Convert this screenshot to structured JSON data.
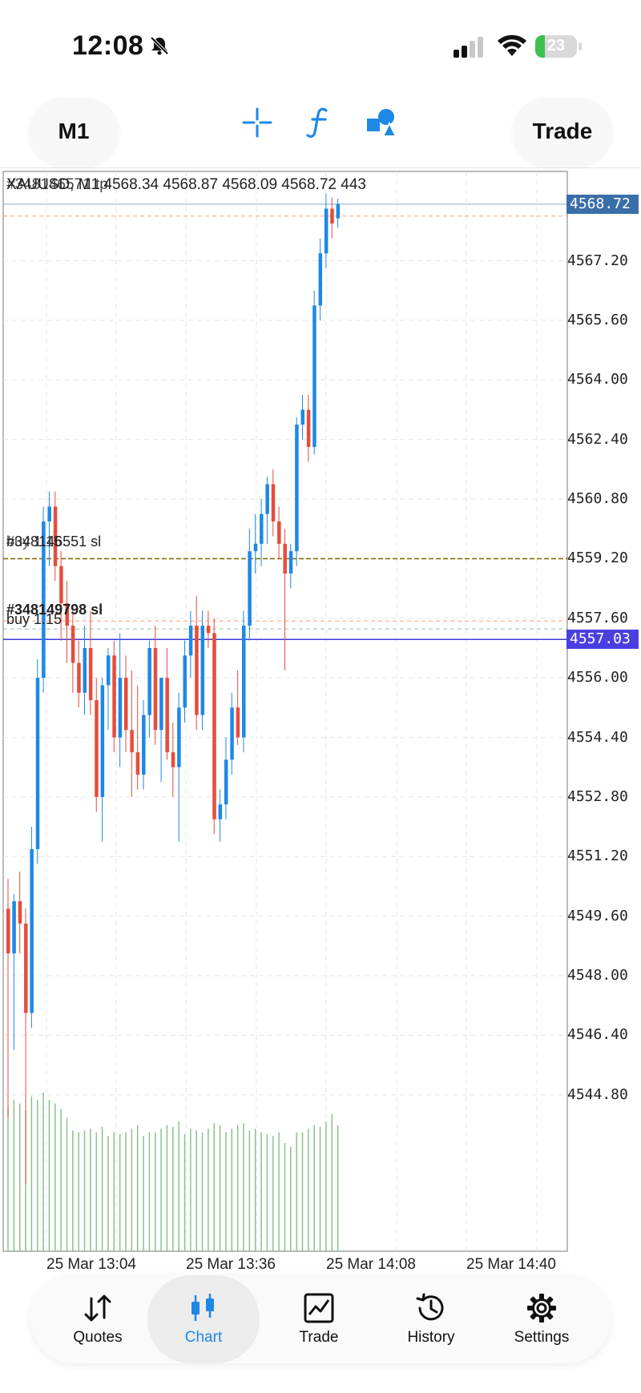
{
  "status_bar": {
    "time": "12:08",
    "battery": "23",
    "battery_level": 0.23
  },
  "toolbar": {
    "timeframe": "M1",
    "trade_label": "Trade",
    "icons": [
      "crosshair-icon",
      "function-icon",
      "objects-icon"
    ]
  },
  "chart": {
    "caption": "XAUUSD, M1 4568.34 4568.87 4568.09 4568.72 443",
    "caption_overlay": "#348146571 tp",
    "orders": [
      {
        "label": "#348146551 sl",
        "sub": "buy 1.15"
      },
      {
        "label": "#348149798 sl",
        "sub": "buy 1.15"
      }
    ],
    "current_price": "4568.72",
    "line_price": "4557.03"
  },
  "chart_data": {
    "type": "candlestick",
    "symbol": "XAUUSD",
    "timeframe": "M1",
    "ohlc_header": {
      "open": 4568.34,
      "high": 4568.87,
      "low": 4568.09,
      "close": 4568.72,
      "volume": 443
    },
    "y_ticks": [
      "4567.20",
      "4565.60",
      "4564.00",
      "4562.40",
      "4560.80",
      "4559.20",
      "4557.60",
      "4556.00",
      "4554.40",
      "4552.80",
      "4551.20",
      "4549.60",
      "4548.00",
      "4546.40",
      "4544.80"
    ],
    "x_ticks": [
      "25 Mar 13:04",
      "25 Mar 13:36",
      "25 Mar 14:08",
      "25 Mar 14:40"
    ],
    "ylim": [
      4540.6,
      4569.6
    ],
    "levels": {
      "tp": 4568.4,
      "sl_upper": 4559.2,
      "sl_lower": 4557.4,
      "blue_line": 4557.03,
      "current": 4568.72
    },
    "candles": [
      [
        4549.8,
        4550.6,
        4544.2,
        4548.6
      ],
      [
        4548.6,
        4550.2,
        4546.0,
        4550.0
      ],
      [
        4550.0,
        4550.8,
        4548.6,
        4549.4
      ],
      [
        4549.4,
        4549.8,
        4542.4,
        4547.0
      ],
      [
        4547.0,
        4552.0,
        4546.6,
        4551.4
      ],
      [
        4551.4,
        4556.5,
        4551.0,
        4556.0
      ],
      [
        4556.0,
        4560.6,
        4555.6,
        4560.2
      ],
      [
        4560.2,
        4561.0,
        4559.0,
        4560.6
      ],
      [
        4560.6,
        4561.0,
        4558.6,
        4559.0
      ],
      [
        4559.0,
        4559.4,
        4557.0,
        4558.0
      ],
      [
        4558.0,
        4558.6,
        4556.4,
        4557.4
      ],
      [
        4557.4,
        4557.8,
        4555.6,
        4556.4
      ],
      [
        4556.4,
        4557.0,
        4555.2,
        4555.6
      ],
      [
        4555.6,
        4557.4,
        4555.0,
        4556.8
      ],
      [
        4556.8,
        4557.8,
        4555.0,
        4555.4
      ],
      [
        4555.4,
        4556.0,
        4552.4,
        4552.8
      ],
      [
        4552.8,
        4556.0,
        4551.6,
        4555.8
      ],
      [
        4555.8,
        4556.8,
        4554.6,
        4556.6
      ],
      [
        4556.6,
        4557.0,
        4554.0,
        4554.4
      ],
      [
        4554.4,
        4557.2,
        4553.6,
        4556.0
      ],
      [
        4556.0,
        4556.6,
        4554.0,
        4554.6
      ],
      [
        4554.6,
        4556.2,
        4552.8,
        4554.0
      ],
      [
        4554.0,
        4555.8,
        4553.0,
        4553.4
      ],
      [
        4553.4,
        4555.4,
        4553.0,
        4555.0
      ],
      [
        4555.0,
        4557.0,
        4554.4,
        4556.8
      ],
      [
        4556.8,
        4557.4,
        4554.2,
        4554.6
      ],
      [
        4554.6,
        4556.0,
        4553.2,
        4556.0
      ],
      [
        4556.0,
        4556.8,
        4553.8,
        4554.0
      ],
      [
        4554.0,
        4554.8,
        4552.8,
        4553.6
      ],
      [
        4553.6,
        4555.6,
        4551.6,
        4555.2
      ],
      [
        4555.2,
        4557.0,
        4554.8,
        4556.6
      ],
      [
        4556.6,
        4557.8,
        4556.0,
        4557.4
      ],
      [
        4557.4,
        4558.2,
        4554.6,
        4555.0
      ],
      [
        4555.0,
        4557.8,
        4554.6,
        4557.4
      ],
      [
        4557.4,
        4557.8,
        4556.8,
        4557.2
      ],
      [
        4557.2,
        4557.6,
        4551.8,
        4552.2
      ],
      [
        4552.2,
        4553.0,
        4551.6,
        4552.6
      ],
      [
        4552.6,
        4554.4,
        4552.2,
        4553.8
      ],
      [
        4553.8,
        4555.6,
        4553.4,
        4555.2
      ],
      [
        4555.2,
        4556.2,
        4554.2,
        4554.4
      ],
      [
        4554.4,
        4557.8,
        4554.0,
        4557.4
      ],
      [
        4557.4,
        4560.0,
        4557.0,
        4559.4
      ],
      [
        4559.4,
        4560.4,
        4558.8,
        4559.6
      ],
      [
        4559.6,
        4560.8,
        4559.0,
        4560.4
      ],
      [
        4560.4,
        4561.4,
        4559.6,
        4561.2
      ],
      [
        4561.2,
        4561.6,
        4559.8,
        4560.2
      ],
      [
        4560.2,
        4560.6,
        4559.2,
        4559.6
      ],
      [
        4559.6,
        4560.0,
        4556.2,
        4558.8
      ],
      [
        4558.8,
        4559.6,
        4558.4,
        4559.4
      ],
      [
        4559.4,
        4563.0,
        4559.0,
        4562.8
      ],
      [
        4562.8,
        4563.6,
        4562.4,
        4563.2
      ],
      [
        4563.2,
        4563.6,
        4561.8,
        4562.2
      ],
      [
        4562.2,
        4566.4,
        4562.0,
        4566.0
      ],
      [
        4566.0,
        4567.8,
        4565.6,
        4567.4
      ],
      [
        4567.4,
        4569.0,
        4567.0,
        4568.6
      ],
      [
        4568.6,
        4568.9,
        4567.8,
        4568.2
      ],
      [
        4568.34,
        4568.87,
        4568.09,
        4568.72
      ]
    ],
    "volumes": [
      400,
      420,
      410,
      390,
      430,
      420,
      440,
      420,
      410,
      395,
      370,
      335,
      330,
      335,
      340,
      330,
      345,
      320,
      330,
      325,
      330,
      340,
      350,
      320,
      330,
      330,
      340,
      350,
      345,
      360,
      325,
      340,
      335,
      330,
      340,
      355,
      350,
      330,
      340,
      350,
      355,
      335,
      340,
      330,
      325,
      320,
      330,
      300,
      290,
      330,
      330,
      340,
      350,
      345,
      360,
      380,
      350
    ]
  },
  "bottom_nav": [
    {
      "label": "Quotes",
      "icon": "quotes-icon"
    },
    {
      "label": "Chart",
      "icon": "chart-icon",
      "active": true
    },
    {
      "label": "Trade",
      "icon": "trade-icon"
    },
    {
      "label": "History",
      "icon": "history-icon"
    },
    {
      "label": "Settings",
      "icon": "settings-icon"
    }
  ],
  "colors": {
    "bull": "#1e88e5",
    "bear": "#e74c3c",
    "volume": "#8cc08c",
    "blue_line": "#3b3bdb",
    "accent": "#1e88e5",
    "current_badge": "#3a6ea8",
    "line_badge": "#4a3fe0"
  }
}
